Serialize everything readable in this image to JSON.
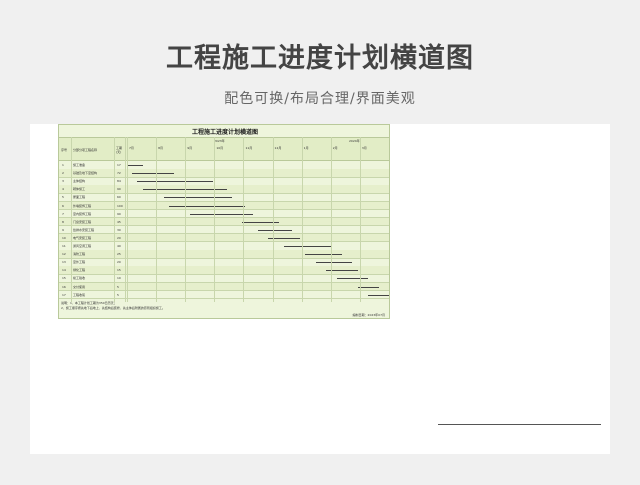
{
  "banner": {
    "title": "工程施工进度计划横道图",
    "subtitle": "配色可换/布局合理/界面美观"
  },
  "sheet": {
    "title": "工程施工进度计划横道图",
    "col_no": "序号",
    "col_task": "分部分项工程名称",
    "col_days": "工期(天)",
    "year1": "2023年",
    "year2": "2024年",
    "months": [
      "7月",
      "8月",
      "9月",
      "10月",
      "11月",
      "12月",
      "1月",
      "2月",
      "3月"
    ],
    "tasks": [
      {
        "no": "1",
        "name": "施工准备",
        "days": "17",
        "start": 0.0,
        "end": 0.06
      },
      {
        "no": "2",
        "name": "基础及地下室结构",
        "days": "72",
        "start": 0.02,
        "end": 0.18
      },
      {
        "no": "3",
        "name": "主体结构",
        "days": "84",
        "start": 0.04,
        "end": 0.33
      },
      {
        "no": "4",
        "name": "砌体施工",
        "days": "90",
        "start": 0.06,
        "end": 0.38
      },
      {
        "no": "5",
        "name": "屋面工程",
        "days": "60",
        "start": 0.14,
        "end": 0.4
      },
      {
        "no": "6",
        "name": "外墙装饰工程",
        "days": "100",
        "start": 0.16,
        "end": 0.45
      },
      {
        "no": "7",
        "name": "室内装饰工程",
        "days": "90",
        "start": 0.24,
        "end": 0.48
      },
      {
        "no": "8",
        "name": "门窗安装工程",
        "days": "45",
        "start": 0.44,
        "end": 0.58
      },
      {
        "no": "9",
        "name": "给排水安装工程",
        "days": "30",
        "start": 0.5,
        "end": 0.63
      },
      {
        "no": "10",
        "name": "电气安装工程",
        "days": "20",
        "start": 0.54,
        "end": 0.66
      },
      {
        "no": "11",
        "name": "通风空调工程",
        "days": "40",
        "start": 0.6,
        "end": 0.78
      },
      {
        "no": "12",
        "name": "消防工程",
        "days": "25",
        "start": 0.68,
        "end": 0.82
      },
      {
        "no": "13",
        "name": "室外工程",
        "days": "20",
        "start": 0.72,
        "end": 0.86
      },
      {
        "no": "14",
        "name": "绿化工程",
        "days": "15",
        "start": 0.76,
        "end": 0.88
      },
      {
        "no": "15",
        "name": "竣工验收",
        "days": "10",
        "start": 0.8,
        "end": 0.92
      },
      {
        "no": "16",
        "name": "交付使用",
        "days": "5",
        "start": 0.88,
        "end": 0.96
      },
      {
        "no": "17",
        "name": "工程收尾",
        "days": "5",
        "start": 0.92,
        "end": 1.0
      }
    ],
    "notes": [
      "说明：1、本工程计划工期为350日历天；",
      "2、施工顺序按先地下后地上、先结构后装修、先主体后附属的原则组织施工。"
    ],
    "sign_label": "编制日期：2023年07月"
  }
}
